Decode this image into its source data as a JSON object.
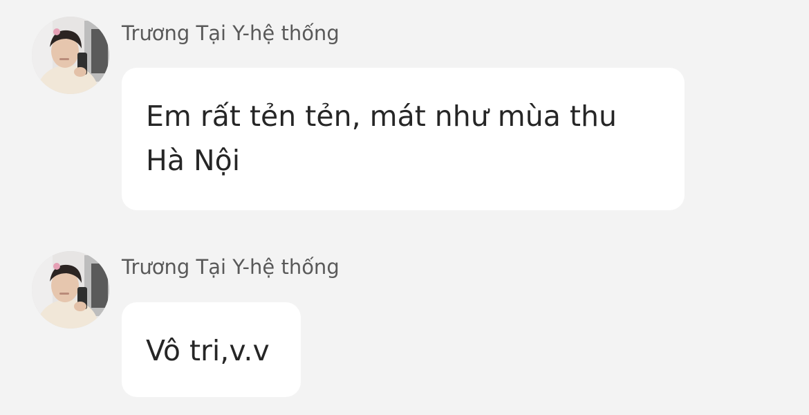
{
  "messages": [
    {
      "sender": "Trương Tại Y-hệ thống",
      "text_line1": "Em rất tẻn tẻn, mát như mùa thu",
      "text_line2": "Hà Nội"
    },
    {
      "sender": "Trương Tại Y-hệ thống",
      "text": "Vô tri,v.v"
    }
  ],
  "colors": {
    "background": "#f3f3f3",
    "bubble": "#ffffff",
    "sender_text": "#595959",
    "message_text": "#262626"
  }
}
